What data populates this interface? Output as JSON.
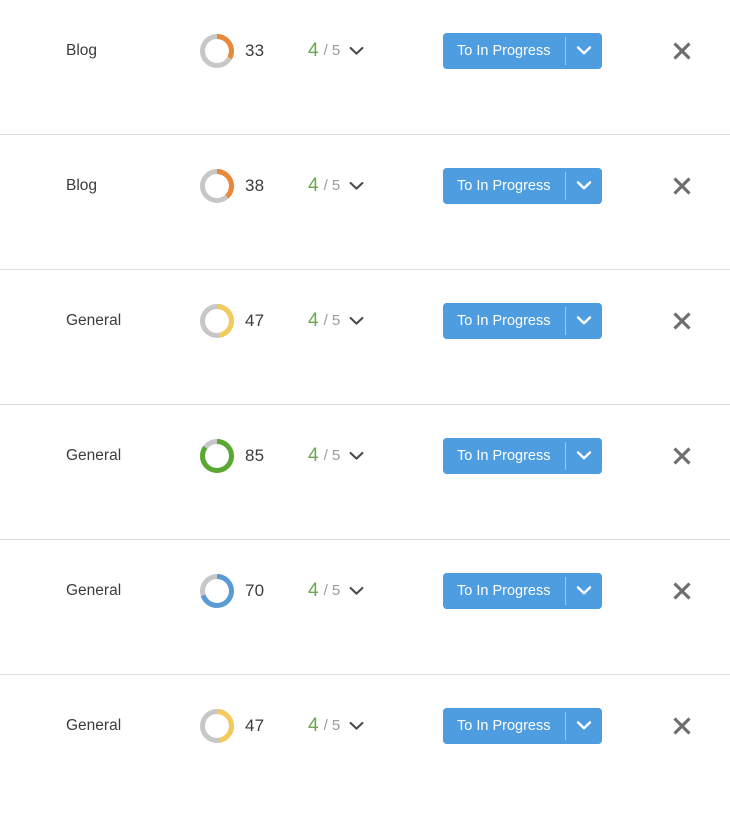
{
  "colors": {
    "accent_button": "#4d9de0",
    "rating_green": "#6aa84f",
    "track_gray": "#c7c7c7",
    "row_divider": "#dcdcdc",
    "close_gray": "#6e6e6e",
    "score_orange": "#e8883a",
    "score_yellow": "#f2cb5c",
    "score_green": "#5aa832",
    "score_blue": "#5b9bd5"
  },
  "icons": {
    "rating_caret": "chevron-down-icon",
    "button_caret": "chevron-down-icon",
    "remove": "close-icon",
    "score": "donut-progress-icon"
  },
  "list": {
    "rows": [
      {
        "category": "Blog",
        "score": 33,
        "score_color": "#e8883a",
        "rating_current": "4",
        "rating_total": "/ 5",
        "action_label": "To In Progress"
      },
      {
        "category": "Blog",
        "score": 38,
        "score_color": "#e8883a",
        "rating_current": "4",
        "rating_total": "/ 5",
        "action_label": "To In Progress"
      },
      {
        "category": "General",
        "score": 47,
        "score_color": "#f2cb5c",
        "rating_current": "4",
        "rating_total": "/ 5",
        "action_label": "To In Progress"
      },
      {
        "category": "General",
        "score": 85,
        "score_color": "#5aa832",
        "rating_current": "4",
        "rating_total": "/ 5",
        "action_label": "To In Progress"
      },
      {
        "category": "General",
        "score": 70,
        "score_color": "#5b9bd5",
        "rating_current": "4",
        "rating_total": "/ 5",
        "action_label": "To In Progress"
      },
      {
        "category": "General",
        "score": 47,
        "score_color": "#f2cb5c",
        "rating_current": "4",
        "rating_total": "/ 5",
        "action_label": "To In Progress"
      }
    ]
  }
}
